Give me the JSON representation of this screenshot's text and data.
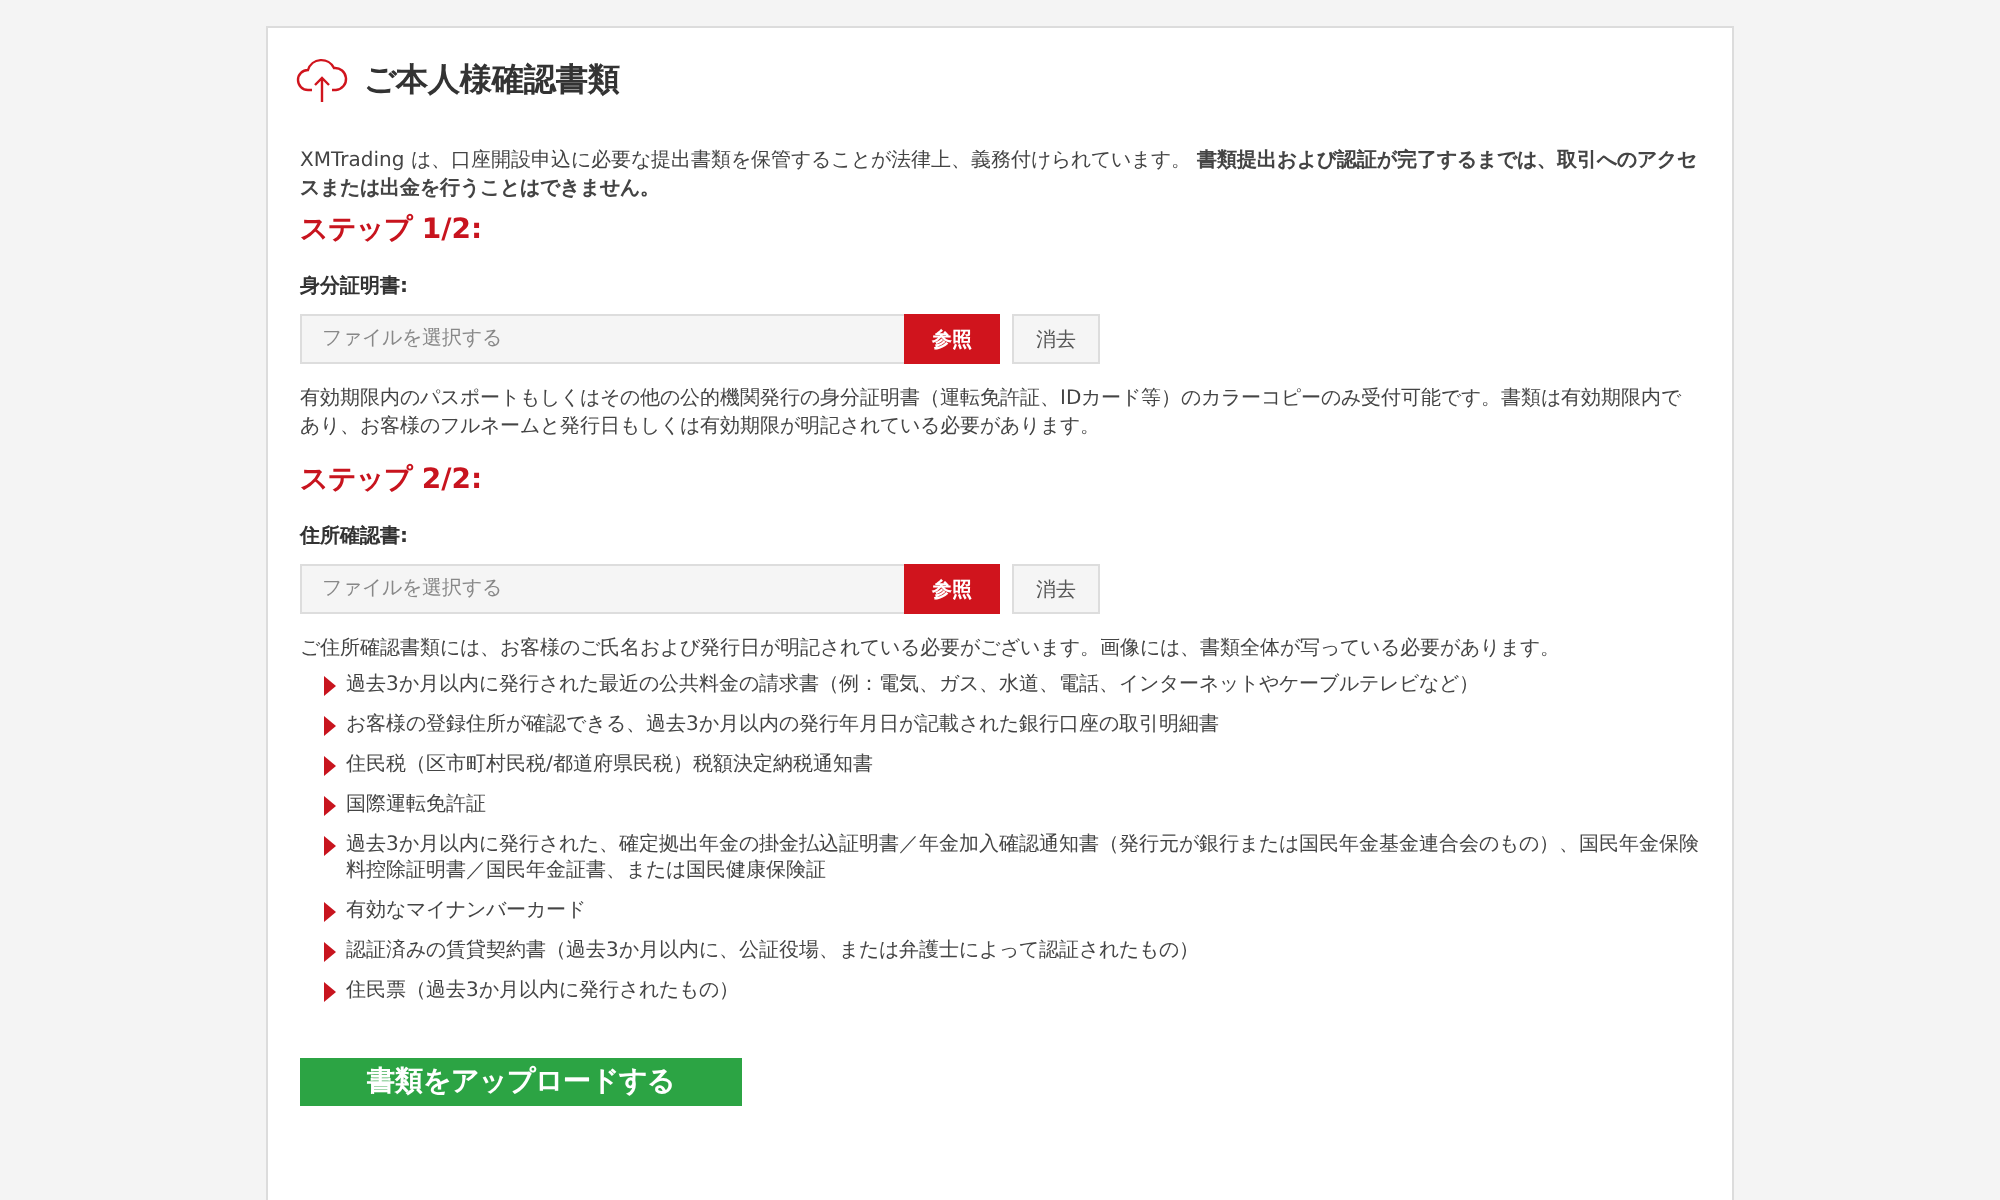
{
  "title": "ご本人様確認書類",
  "intro": "XMTrading は、口座開設申込に必要な提出書類を保管することが法律上、義務付けられています。 **書類提出および認証が完了するまでは、取引へのアクセスまたは出金を行うことはできません。**",
  "steps": [
    {
      "heading": "ステップ 1/2:",
      "field_label": "身分証明書:",
      "file_field": {
        "placeholder": "ファイルを選択する"
      },
      "browse_button": "参照",
      "clear_button": "消去",
      "note": "有効期限内のパスポートもしくはその他の公的機関発行の身分証明書（運転免許証、IDカード等）のカラーコピーのみ受付可能です。書類は有効期限内であり、お客様のフルネームと発行日もしくは有効期限が明記されている必要があります。"
    },
    {
      "heading": "ステップ 2/2:",
      "field_label": "住所確認書:",
      "file_field": {
        "placeholder": "ファイルを選択する"
      },
      "browse_button": "参照",
      "clear_button": "消去",
      "note": "ご住所確認書類には、お客様のご氏名および発行日が明記されている必要がございます。画像には、書類全体が写っている必要があります。",
      "items": [
        "過去3か月以内に発行された最近の公共料金の請求書（例：電気、ガス、水道、電話、インターネットやケーブルテレビなど）",
        "お客様の登録住所が確認できる、過去3か月以内の発行年月日が記載された銀行口座の取引明細書",
        "住民税（区市町村民税/都道府県民税）税額決定納税通知書",
        "国際運転免許証",
        "過去3か月以内に発行された、確定拠出年金の掛金払込証明書／年金加入確認通知書（発行元が銀行または国民年金基金連合会のもの）、国民年金保険料控除証明書／国民年金証書、または国民健康保険証",
        "有効なマイナンバーカード",
        "認証済みの賃貸契約書（過去3か月以内に、公証役場、または弁護士によって認証されたもの）",
        "住民票（過去3か月以内に発行されたもの）"
      ]
    }
  ],
  "submit_button": "書類をアップロードする"
}
